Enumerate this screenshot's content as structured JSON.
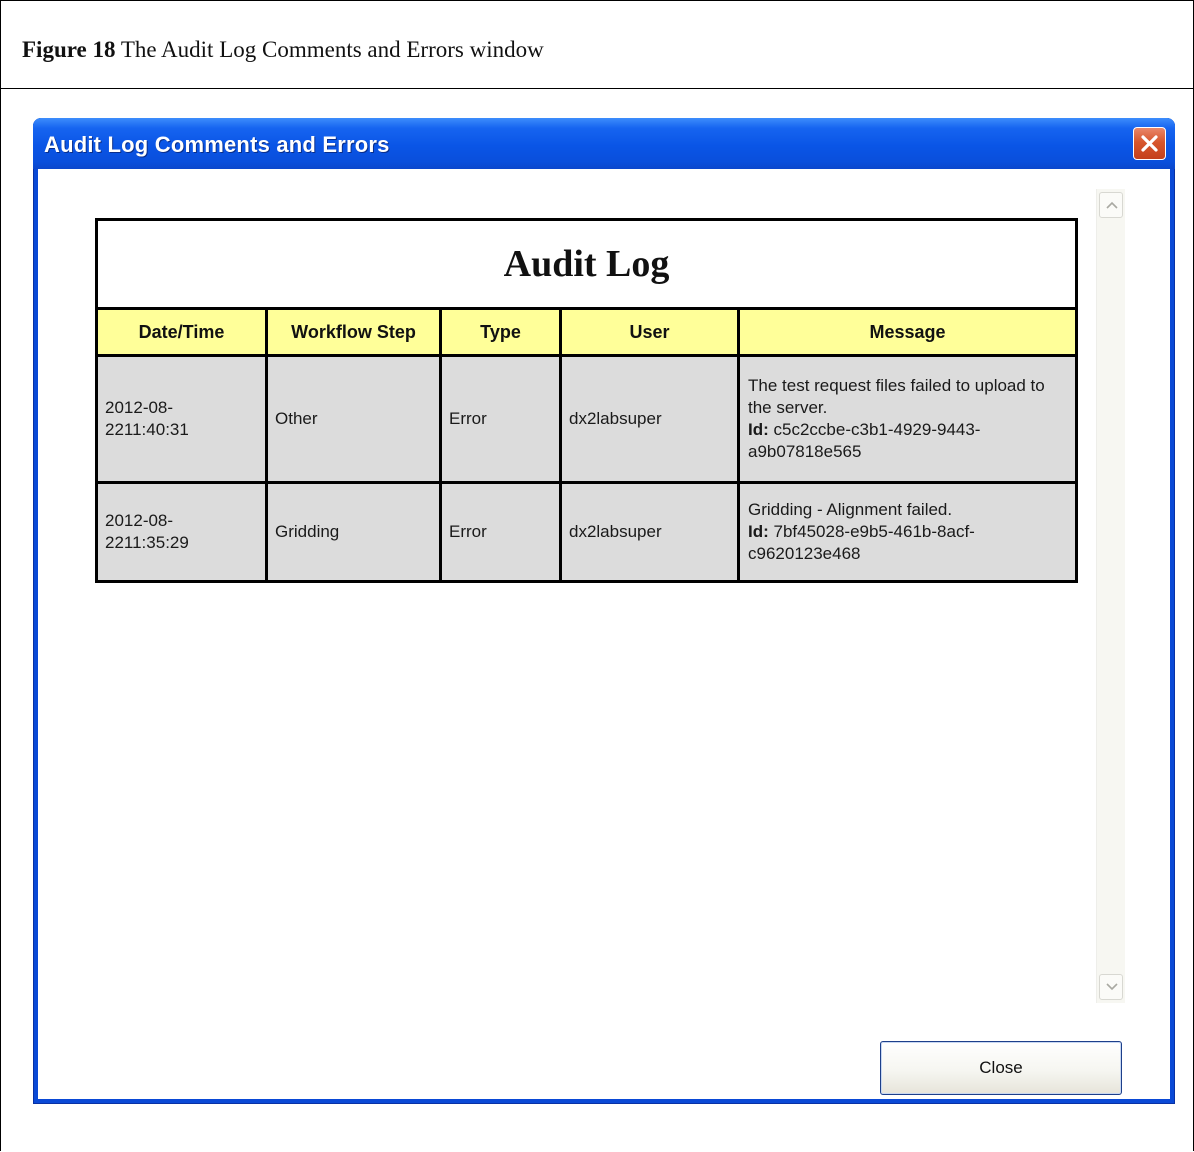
{
  "caption": {
    "number": "Figure 18",
    "text": " The Audit Log Comments and Errors window"
  },
  "window": {
    "title": "Audit Log Comments and Errors"
  },
  "audit_log": {
    "title": "Audit Log",
    "columns": [
      "Date/Time",
      "Workflow Step",
      "Type",
      "User",
      "Message"
    ],
    "rows": [
      {
        "datetime_line1": "2012-08-",
        "datetime_line2": "2211:40:31",
        "workflow_step": "Other",
        "type": "Error",
        "user": "dx2labsuper",
        "message": "The test request files failed to upload to the server.",
        "id_label": "Id:",
        "id_value": " c5c2ccbe-c3b1-4929-9443-a9b07818e565"
      },
      {
        "datetime_line1": "2012-08-",
        "datetime_line2": "2211:35:29",
        "workflow_step": "Gridding",
        "type": "Error",
        "user": "dx2labsuper",
        "message": "Gridding - Alignment failed.",
        "id_label": "Id:",
        "id_value": " 7bf45028-e9b5-461b-8acf-c9620123e468"
      }
    ]
  },
  "buttons": {
    "close_label": "Close"
  },
  "colors": {
    "titlebar": "#0a55e6",
    "header_fill": "#ffff99",
    "row_fill": "#dcdcdc",
    "close_x": "#d7562d"
  },
  "icons": {
    "window_close": "close-icon",
    "scroll_up": "chevron-up-icon",
    "scroll_down": "chevron-down-icon"
  }
}
